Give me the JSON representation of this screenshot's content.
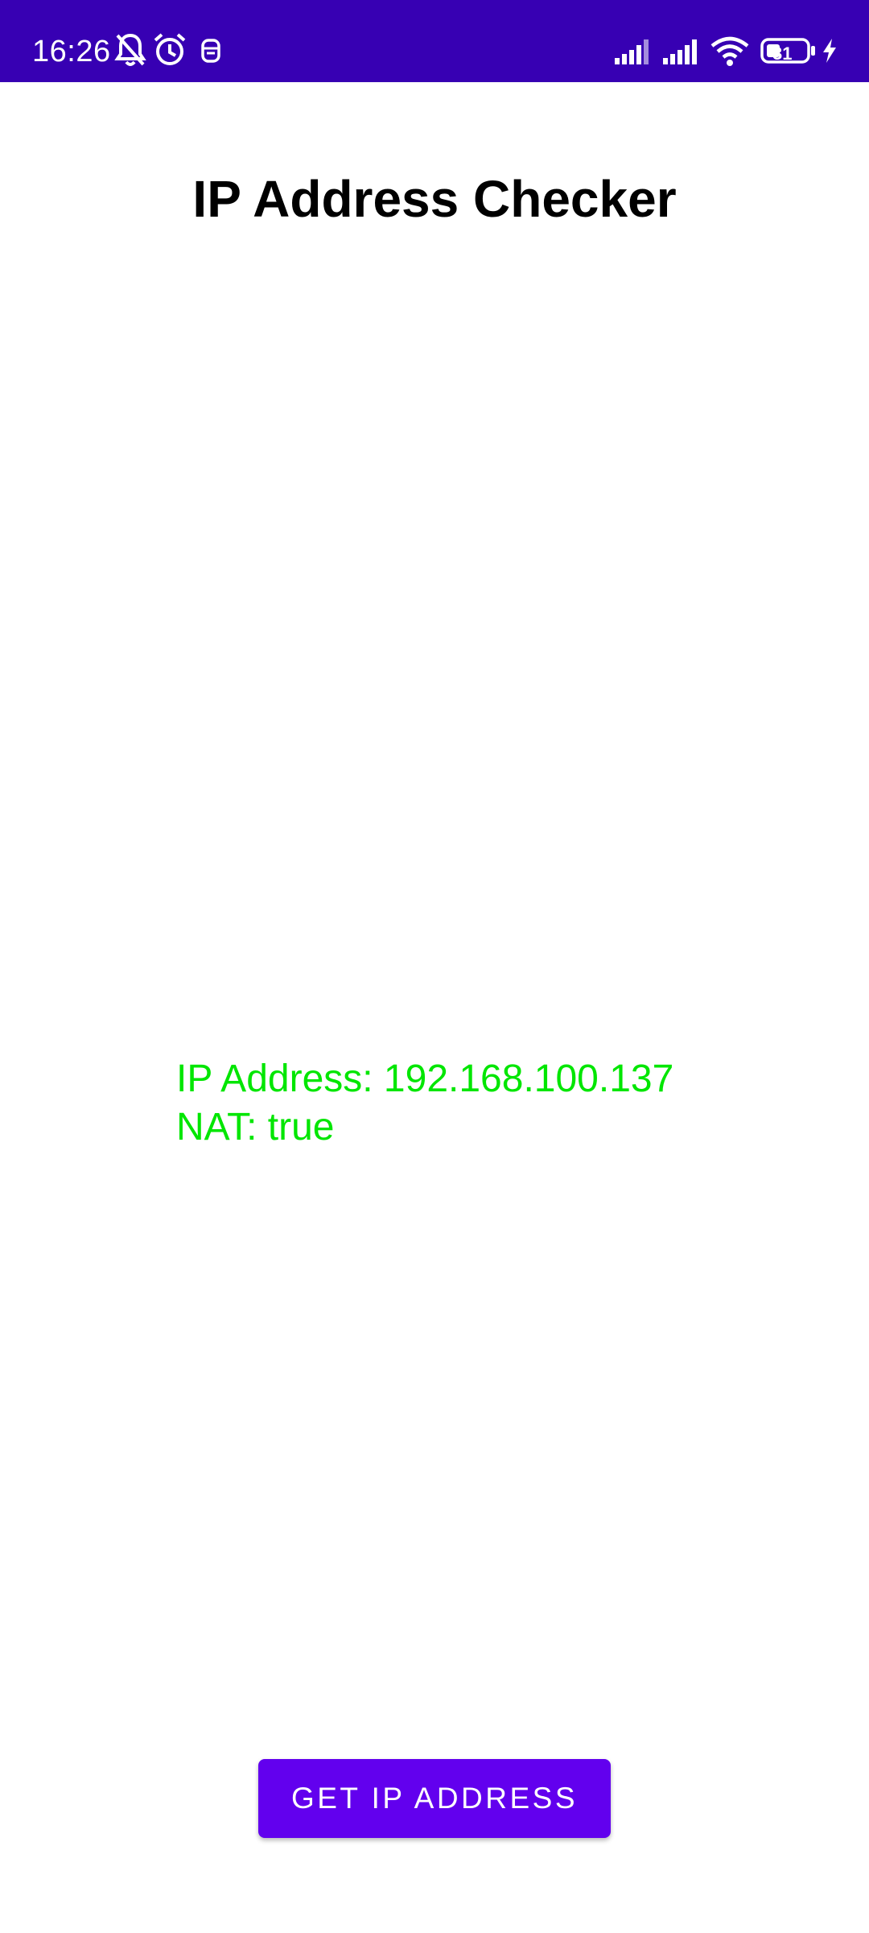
{
  "status_bar": {
    "time": "16:26",
    "battery_level": "31",
    "background_color": "#3700B3",
    "icons": [
      "notifications-off-icon",
      "alarm-icon",
      "app-notification-icon",
      "cell-signal-icon",
      "cell-signal-icon",
      "wifi-icon",
      "battery-icon",
      "charging-icon"
    ]
  },
  "app": {
    "title": "IP Address Checker"
  },
  "result": {
    "ip_line": "IP Address: 192.168.100.137",
    "nat_line": "NAT: true",
    "text_color": "#00E600"
  },
  "actions": {
    "get_ip_label": "GET IP ADDRESS",
    "button_color": "#6200EE"
  }
}
